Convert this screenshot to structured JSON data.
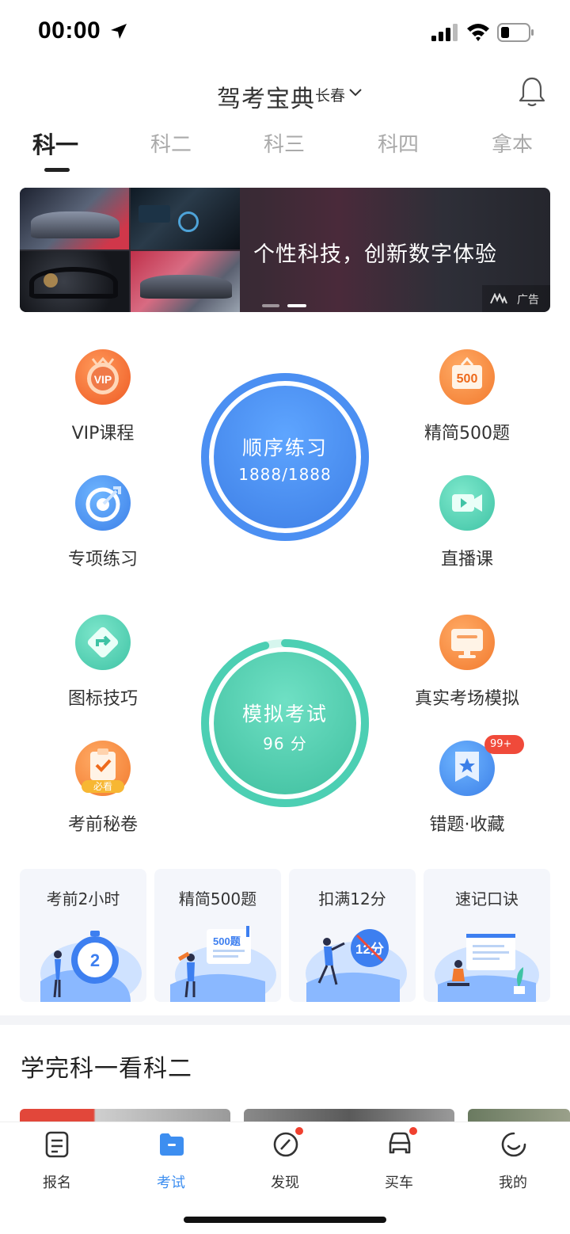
{
  "status_bar": {
    "time": "00:00"
  },
  "header": {
    "title": "驾考宝典",
    "city": "长春"
  },
  "tabs": [
    {
      "label": "科一",
      "active": true
    },
    {
      "label": "科二"
    },
    {
      "label": "科三"
    },
    {
      "label": "科四"
    },
    {
      "label": "拿本"
    }
  ],
  "banner": {
    "headline": "个性科技，创新数字体验",
    "ad_label": "广告",
    "slide_count": 2,
    "active_slide": 2
  },
  "features_left_top": [
    {
      "label": "VIP课程",
      "icon": "vip-icon"
    },
    {
      "label": "专项练习",
      "icon": "target-icon"
    }
  ],
  "features_right_top": [
    {
      "label": "精简500题",
      "icon": "500-icon"
    },
    {
      "label": "直播课",
      "icon": "live-video-icon"
    }
  ],
  "features_left_bottom": [
    {
      "label": "图标技巧",
      "icon": "road-sign-icon"
    },
    {
      "label": "考前秘卷",
      "icon": "exam-paper-icon",
      "tag": "必看"
    }
  ],
  "features_right_bottom": [
    {
      "label": "真实考场模拟",
      "icon": "monitor-icon"
    },
    {
      "label": "错题·收藏",
      "icon": "favorite-icon",
      "badge": "99+"
    }
  ],
  "practice": {
    "title": "顺序练习",
    "progress_text": "1888/1888",
    "progress": 1.0
  },
  "mock_exam": {
    "title": "模拟考试",
    "score_text": "96 分",
    "progress": 0.96
  },
  "cards": [
    {
      "title": "考前2小时",
      "icon": "stopwatch-2-icon"
    },
    {
      "title": "精简500题",
      "icon": "500-questions-icon"
    },
    {
      "title": "扣满12分",
      "icon": "12-points-icon"
    },
    {
      "title": "速记口诀",
      "icon": "mnemonic-board-icon"
    }
  ],
  "section": {
    "title": "学完科一看科二"
  },
  "nav": [
    {
      "label": "报名",
      "icon": "register-icon"
    },
    {
      "label": "考试",
      "icon": "exam-folder-icon",
      "active": true
    },
    {
      "label": "发现",
      "icon": "compass-icon",
      "dot": true
    },
    {
      "label": "买车",
      "icon": "car-icon",
      "dot": true
    },
    {
      "label": "我的",
      "icon": "smile-icon"
    }
  ],
  "colors": {
    "accent_blue": "#3d8ef0",
    "practice_blue": "#4b8ff2",
    "mock_green": "#4ccfb3",
    "orange": "#f27a2e",
    "badge_red": "#f04a3a"
  }
}
